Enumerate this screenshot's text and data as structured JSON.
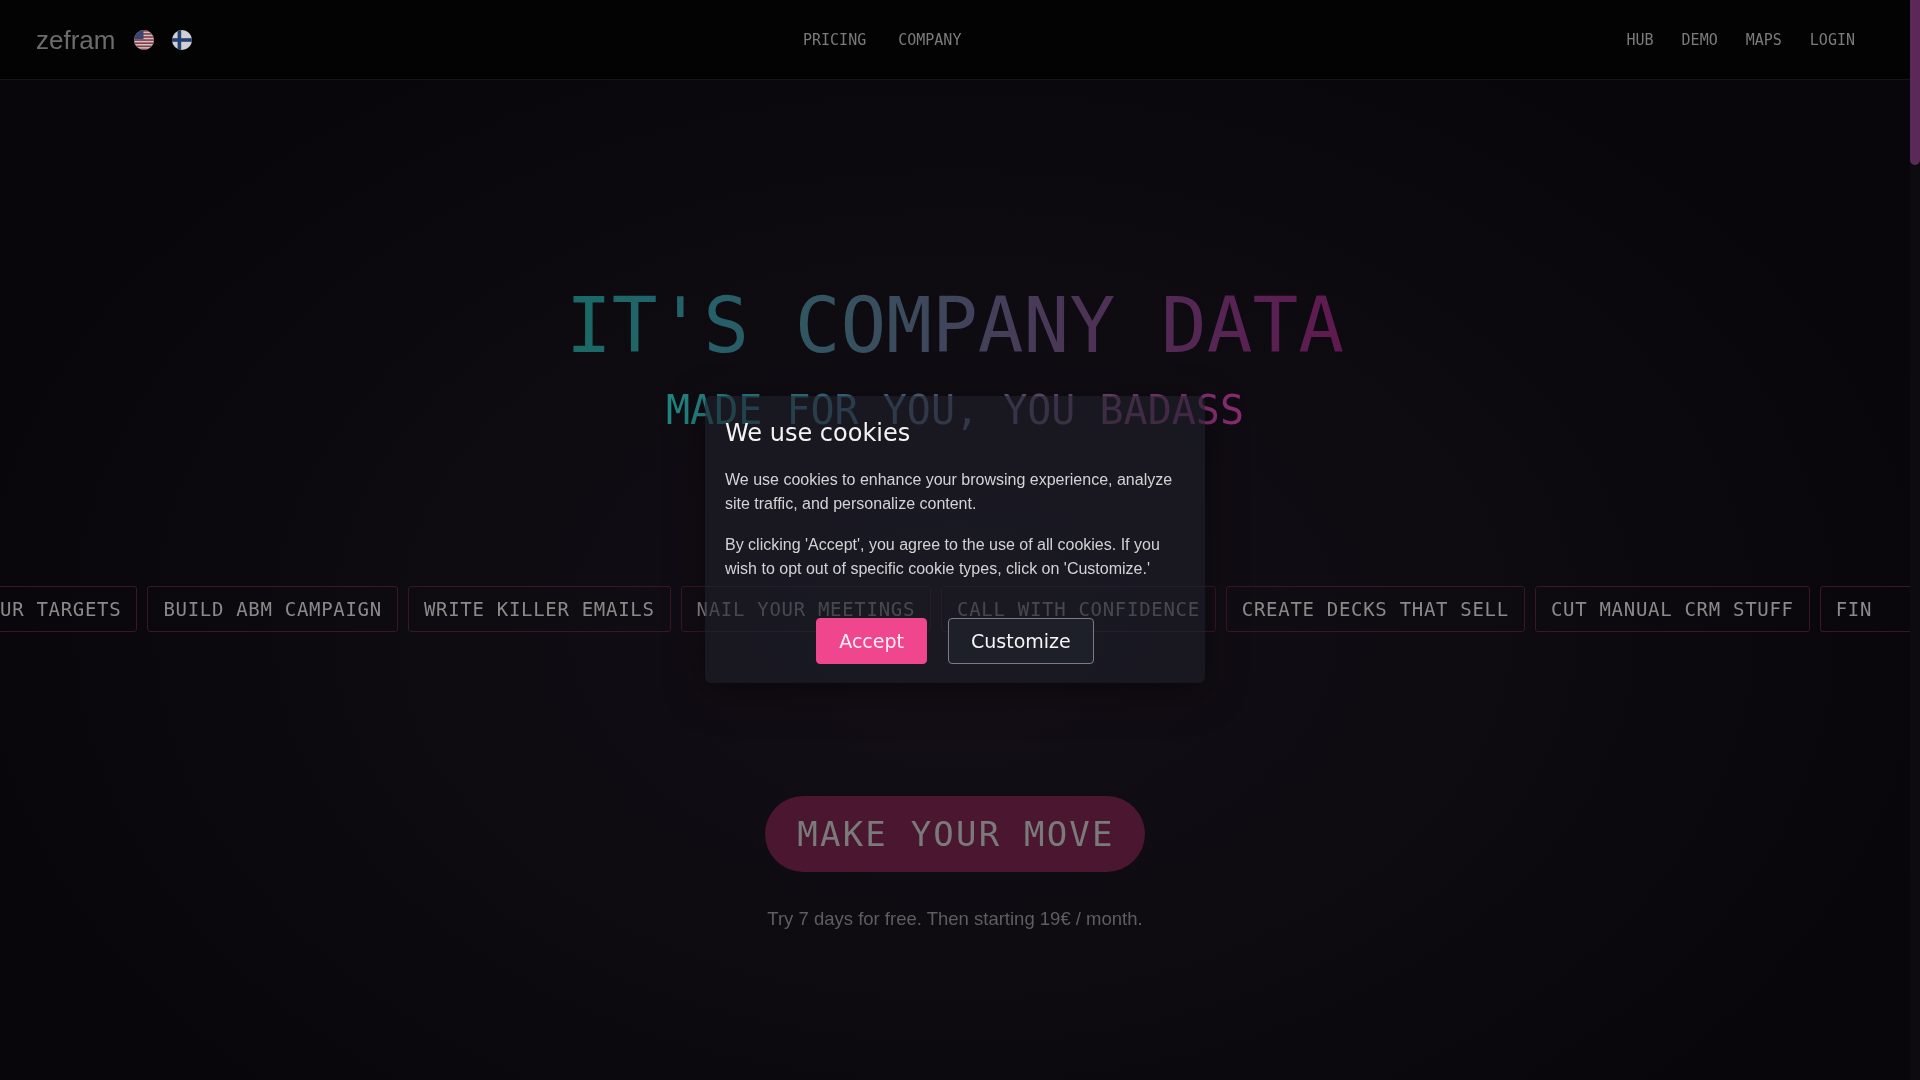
{
  "header": {
    "logo": "zefram",
    "nav_center": [
      "PRICING",
      "COMPANY"
    ],
    "nav_right": [
      "HUB",
      "DEMO",
      "MAPS",
      "LOGIN"
    ]
  },
  "hero": {
    "title": "IT'S COMPANY DATA",
    "subtitle": "MADE FOR YOU, YOU BADASS"
  },
  "use_cases": [
    "UR TARGETS",
    "BUILD ABM CAMPAIGN",
    "WRITE KILLER EMAILS",
    "NAIL YOUR MEETINGS",
    "CALL WITH CONFIDENCE",
    "CREATE DECKS THAT SELL",
    "CUT MANUAL CRM STUFF",
    "FIN"
  ],
  "cta": {
    "button": "MAKE YOUR MOVE",
    "note": "Try 7 days for free. Then starting 19€ / month."
  },
  "cookie_dialog": {
    "title": "We use cookies",
    "paragraphs": [
      "We use cookies to enhance your browsing experience, analyze site traffic, and personalize content.",
      "By clicking 'Accept', you agree to the use of all cookies. If you wish to opt out of specific cookie types, click on 'Customize.'"
    ],
    "buttons": [
      {
        "label": "Accept",
        "kind": "primary"
      },
      {
        "label": "Customize",
        "kind": "secondary"
      }
    ]
  }
}
